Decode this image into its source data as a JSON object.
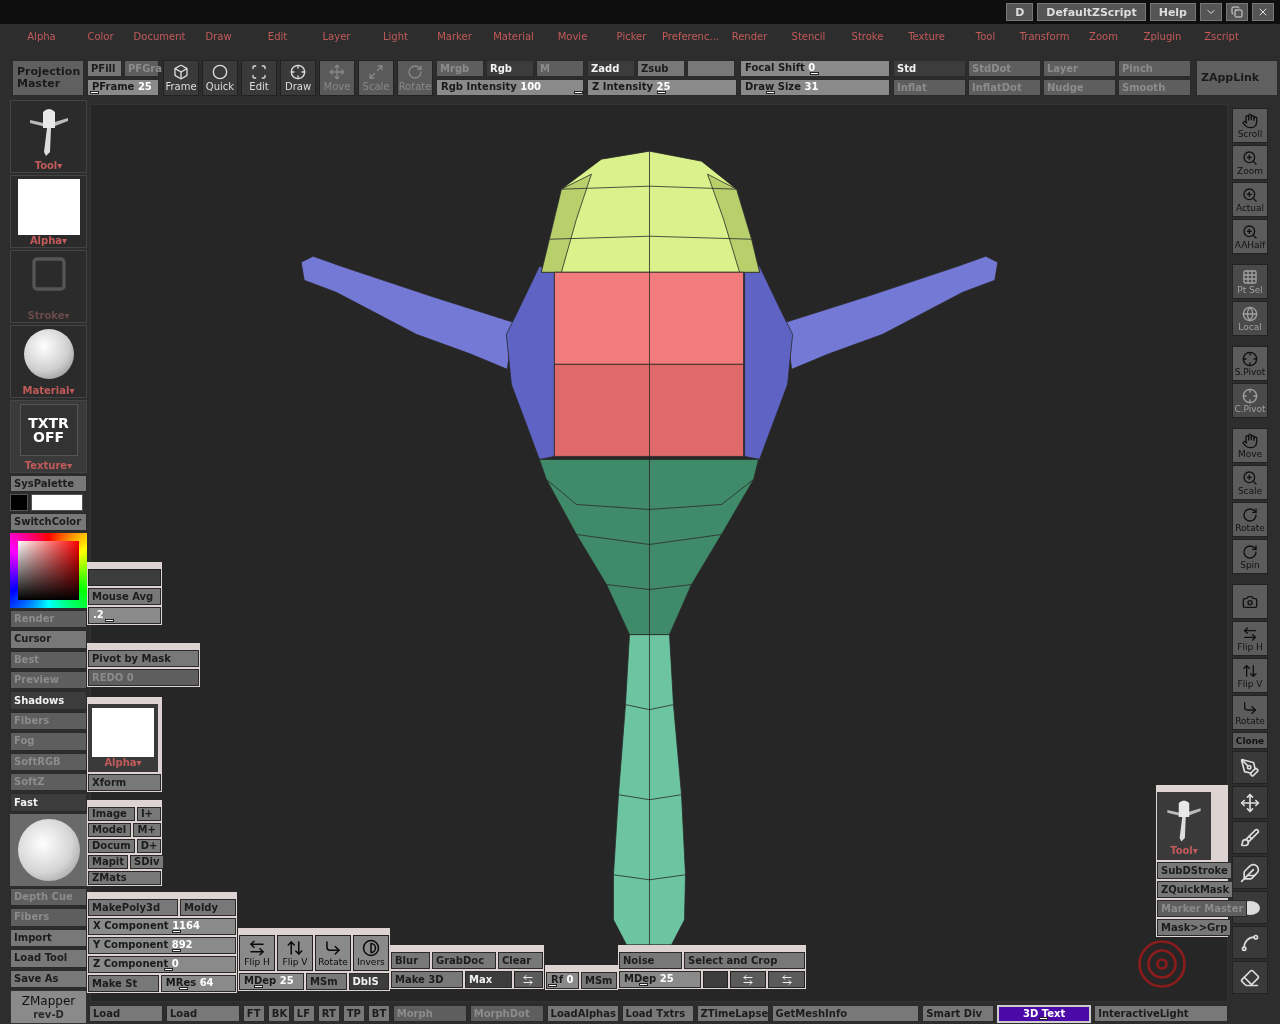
{
  "title_bar": {
    "buttons": [
      "D",
      "DefaultZScript",
      "Help"
    ]
  },
  "menu": [
    "Alpha",
    "Color",
    "Document",
    "Draw",
    "Edit",
    "Layer",
    "Light",
    "Marker",
    "Material",
    "Movie",
    "Picker",
    "Preferenc...",
    "Render",
    "Stencil",
    "Stroke",
    "Texture",
    "Tool",
    "Transform",
    "Zoom",
    "Zplugin",
    "Zscript"
  ],
  "toolbar": {
    "projection_master": "Projection Master",
    "pfill": [
      {
        "label": "PFill",
        "disabled": false
      },
      {
        "label": "PFGra",
        "disabled": true
      }
    ],
    "pframe": {
      "label": "PFrame",
      "value": "25",
      "level": 0.1
    },
    "modes": [
      {
        "label": "Frame",
        "disabled": false
      },
      {
        "label": "Quick",
        "disabled": false
      },
      {
        "label": "Edit",
        "disabled": false
      },
      {
        "label": "Draw",
        "disabled": false
      },
      {
        "label": "Move",
        "disabled": true
      },
      {
        "label": "Scale",
        "disabled": true
      },
      {
        "label": "Rotate",
        "disabled": true
      }
    ],
    "color_modes": [
      {
        "label": "Mrgb",
        "selected": false
      },
      {
        "label": "Rgb",
        "selected": true
      },
      {
        "label": "M",
        "selected": false
      }
    ],
    "rgb_intensity": {
      "label": "Rgb Intensity",
      "value": "100",
      "level": 0.97
    },
    "z_modes": [
      {
        "label": "Zadd",
        "selected": true
      },
      {
        "label": "Zsub",
        "selected": false
      },
      {
        "selected": false
      }
    ],
    "z_intensity": {
      "label": "Z Intensity",
      "value": "25",
      "level": 0.5
    },
    "focal_shift": {
      "label": "Focal Shift",
      "value": "0",
      "level": 0.5
    },
    "draw_size": {
      "label": "Draw Size",
      "value": "31",
      "level": 0.2
    },
    "brushes": [
      {
        "label": "Std",
        "selected": true
      },
      {
        "label": "StdDot",
        "selected": false
      },
      {
        "label": "Layer",
        "selected": false
      },
      {
        "label": "Pinch",
        "selected": false
      },
      {
        "label": "Inflat",
        "selected": false
      },
      {
        "label": "InflatDot",
        "selected": false
      },
      {
        "label": "Nudge",
        "selected": false
      },
      {
        "label": "Smooth",
        "selected": false
      }
    ],
    "zapplink": "ZAppLink"
  },
  "left_shelf": {
    "thumbs": [
      {
        "kind": "tool",
        "label": "Tool",
        "mark": "▾",
        "disabled": false
      },
      {
        "kind": "alpha",
        "label": "Alpha",
        "mark": "▾",
        "disabled": false
      },
      {
        "kind": "stroke",
        "label": "Stroke",
        "mark": "▾",
        "disabled": true
      },
      {
        "kind": "material",
        "label": "Material",
        "mark": "▾",
        "disabled": false
      },
      {
        "kind": "texture",
        "label": "Texture",
        "text": "TXTR OFF",
        "mark": "▾",
        "disabled": false
      }
    ],
    "syspalette": "SysPalette",
    "swatches": [
      {
        "color": "#000000"
      },
      {
        "color": "#ffffff"
      }
    ],
    "switchcolor": "SwitchColor",
    "render_buttons": [
      {
        "label": "Render",
        "selected": false,
        "disabled": true
      },
      {
        "label": "Cursor",
        "selected": false,
        "disabled": false
      },
      {
        "label": "Best",
        "selected": false,
        "disabled": true
      },
      {
        "label": "Preview",
        "selected": false,
        "disabled": true
      },
      {
        "label": "Shadows",
        "selected": true,
        "disabled": false
      },
      {
        "label": "Fibers",
        "selected": false,
        "disabled": true
      },
      {
        "label": "Fog",
        "selected": false,
        "disabled": true
      },
      {
        "label": "SoftRGB",
        "selected": false,
        "disabled": true
      },
      {
        "label": "SoftZ",
        "selected": false,
        "disabled": true
      },
      {
        "label": "Fast",
        "selected": true,
        "disabled": false
      }
    ],
    "file_buttons": [
      {
        "label": "Depth Cue",
        "disabled": true
      },
      {
        "label": "Fibers",
        "disabled": true
      },
      {
        "label": "Import",
        "disabled": false
      },
      {
        "label": "Load Tool",
        "disabled": false
      },
      {
        "label": "Save As",
        "disabled": false
      }
    ],
    "zmapper": {
      "title": "ZMapper",
      "subtitle": "rev-D"
    }
  },
  "right_shelf": [
    {
      "label": "Scroll",
      "disabled": false
    },
    {
      "label": "Zoom",
      "disabled": false
    },
    {
      "label": "Actual",
      "disabled": false
    },
    {
      "label": "AAHalf",
      "disabled": false
    },
    {
      "label": "Pt Sel",
      "disabled": true
    },
    {
      "label": "Local",
      "disabled": true
    },
    {
      "label": "S.Pivot",
      "disabled": false
    },
    {
      "label": "C.Pivot",
      "disabled": true
    },
    {
      "label": "Move",
      "disabled": false
    },
    {
      "label": "Scale",
      "disabled": false
    },
    {
      "label": "Rotate",
      "disabled": false
    },
    {
      "label": "Spin",
      "disabled": false
    },
    {
      "disabled": false
    },
    {
      "label": "Flip H",
      "disabled": false
    },
    {
      "label": "Flip V",
      "disabled": false
    },
    {
      "label": "Rotate",
      "disabled": false
    },
    {
      "label": "Clone",
      "disabled": false
    }
  ],
  "float_panels": [
    {
      "rows": [
        [
          {
            "kind": "blank"
          }
        ],
        [
          {
            "kind": "button",
            "label": "Mouse Avg"
          }
        ],
        [
          {
            "kind": "slider",
            "value": ".2",
            "level": 0.3
          }
        ]
      ]
    },
    {
      "rows": [
        [
          {
            "kind": "button",
            "label": "Pivot by Mask"
          }
        ],
        [
          {
            "kind": "faint",
            "label": "REDO 0"
          }
        ]
      ]
    },
    {
      "rows": [
        [
          {
            "kind": "alpha_thumb",
            "label": "Alpha",
            "mark": "▾"
          }
        ],
        [
          {
            "kind": "button",
            "label": "Xform"
          }
        ]
      ]
    },
    {
      "rows": [
        [
          {
            "kind": "button",
            "label": "Image"
          },
          {
            "kind": "button",
            "label": "I+"
          }
        ],
        [
          {
            "kind": "button",
            "label": "Model"
          },
          {
            "kind": "button",
            "label": "M+"
          }
        ],
        [
          {
            "kind": "button",
            "label": "Docum"
          },
          {
            "kind": "button",
            "label": "D+"
          }
        ],
        [
          {
            "kind": "button",
            "label": "Mapit"
          },
          {
            "kind": "button",
            "label": "SDiv"
          }
        ],
        [
          {
            "kind": "button",
            "label": "ZMats"
          }
        ]
      ]
    },
    {
      "rows": [
        [
          {
            "kind": "button",
            "label": "MakePoly3d"
          },
          {
            "kind": "button",
            "label": "Moldy"
          }
        ],
        [
          {
            "kind": "slider",
            "label": "X Component",
            "value": "1164",
            "level": 0.6
          }
        ],
        [
          {
            "kind": "slider",
            "label": "Y Component",
            "value": "892",
            "level": 0.6
          }
        ],
        [
          {
            "kind": "slider",
            "label": "Z Component",
            "value": "0",
            "level": 0.55
          }
        ],
        [
          {
            "kind": "button",
            "label": "Make St"
          },
          {
            "kind": "slider",
            "label": "MRes",
            "value": "64",
            "level": 0.3
          }
        ]
      ]
    },
    {
      "icons": [
        {
          "kind": "icon_button",
          "label": "Flip H"
        },
        {
          "kind": "icon_button",
          "label": "Flip V"
        },
        {
          "kind": "icon_button",
          "label": "Rotate"
        },
        {
          "kind": "icon_button",
          "label": "Invers"
        }
      ],
      "rows": [
        [
          {
            "kind": "slider",
            "label": "MDep",
            "value": "25",
            "level": 0.3
          },
          {
            "kind": "button",
            "label": "MSm"
          },
          {
            "kind": "selected",
            "label": "DblS"
          }
        ]
      ]
    },
    {
      "rows": [
        [
          {
            "kind": "button",
            "label": "Blur"
          },
          {
            "kind": "button",
            "label": "GrabDoc"
          },
          {
            "kind": "button",
            "label": "Clear"
          }
        ],
        [
          {
            "kind": "button",
            "label": "Make 3D"
          },
          {
            "kind": "selected",
            "label": "Max"
          },
          {
            "kind": "icon_button"
          }
        ]
      ]
    },
    {
      "rows": [
        [
          {
            "kind": "slider",
            "label": "Rf",
            "value": "0",
            "level": 0.2
          },
          {
            "kind": "button",
            "label": "MSm"
          }
        ]
      ]
    },
    {
      "rows": [
        [
          {
            "kind": "button",
            "label": "Noise"
          },
          {
            "kind": "button",
            "label": "Select and Crop"
          }
        ],
        [
          {
            "kind": "slider",
            "label": "MDep",
            "value": "25",
            "level": 0.3
          },
          {
            "kind": "blank"
          },
          {
            "kind": "icon_button"
          },
          {
            "kind": "icon_button"
          }
        ]
      ]
    },
    {
      "rows": [
        [
          {
            "kind": "tool_thumb",
            "label": "Tool",
            "mark": "▾"
          }
        ],
        [
          {
            "kind": "button",
            "label": "SubDStroke"
          }
        ],
        [
          {
            "kind": "button",
            "label": "ZQuickMask"
          }
        ],
        [
          {
            "kind": "faint",
            "label": "Marker Master"
          }
        ],
        [
          {
            "kind": "button",
            "label": "Mask>>Grp"
          }
        ]
      ]
    }
  ],
  "bottom_bar": [
    {
      "kind": "button",
      "label": "Load"
    },
    {
      "kind": "button",
      "label": "Load"
    },
    {
      "kind": "small",
      "label": "FT"
    },
    {
      "kind": "small",
      "label": "BK"
    },
    {
      "kind": "small",
      "label": "LF"
    },
    {
      "kind": "small",
      "label": "RT"
    },
    {
      "kind": "small",
      "label": "TP"
    },
    {
      "kind": "small",
      "label": "BT"
    },
    {
      "kind": "faint",
      "label": "Morph"
    },
    {
      "kind": "faint",
      "label": "MorphDot"
    },
    {
      "kind": "button",
      "label": "LoadAlphas"
    },
    {
      "kind": "button",
      "label": "Load Txtrs"
    },
    {
      "kind": "button",
      "label": "ZTimeLapse"
    },
    {
      "kind": "wide",
      "label": "GetMeshInfo"
    },
    {
      "kind": "button",
      "label": "Smart Div"
    },
    {
      "kind": "slider",
      "label": "3D Text",
      "level": 0.5
    },
    {
      "kind": "wide",
      "label": "InteractiveLight"
    }
  ]
}
